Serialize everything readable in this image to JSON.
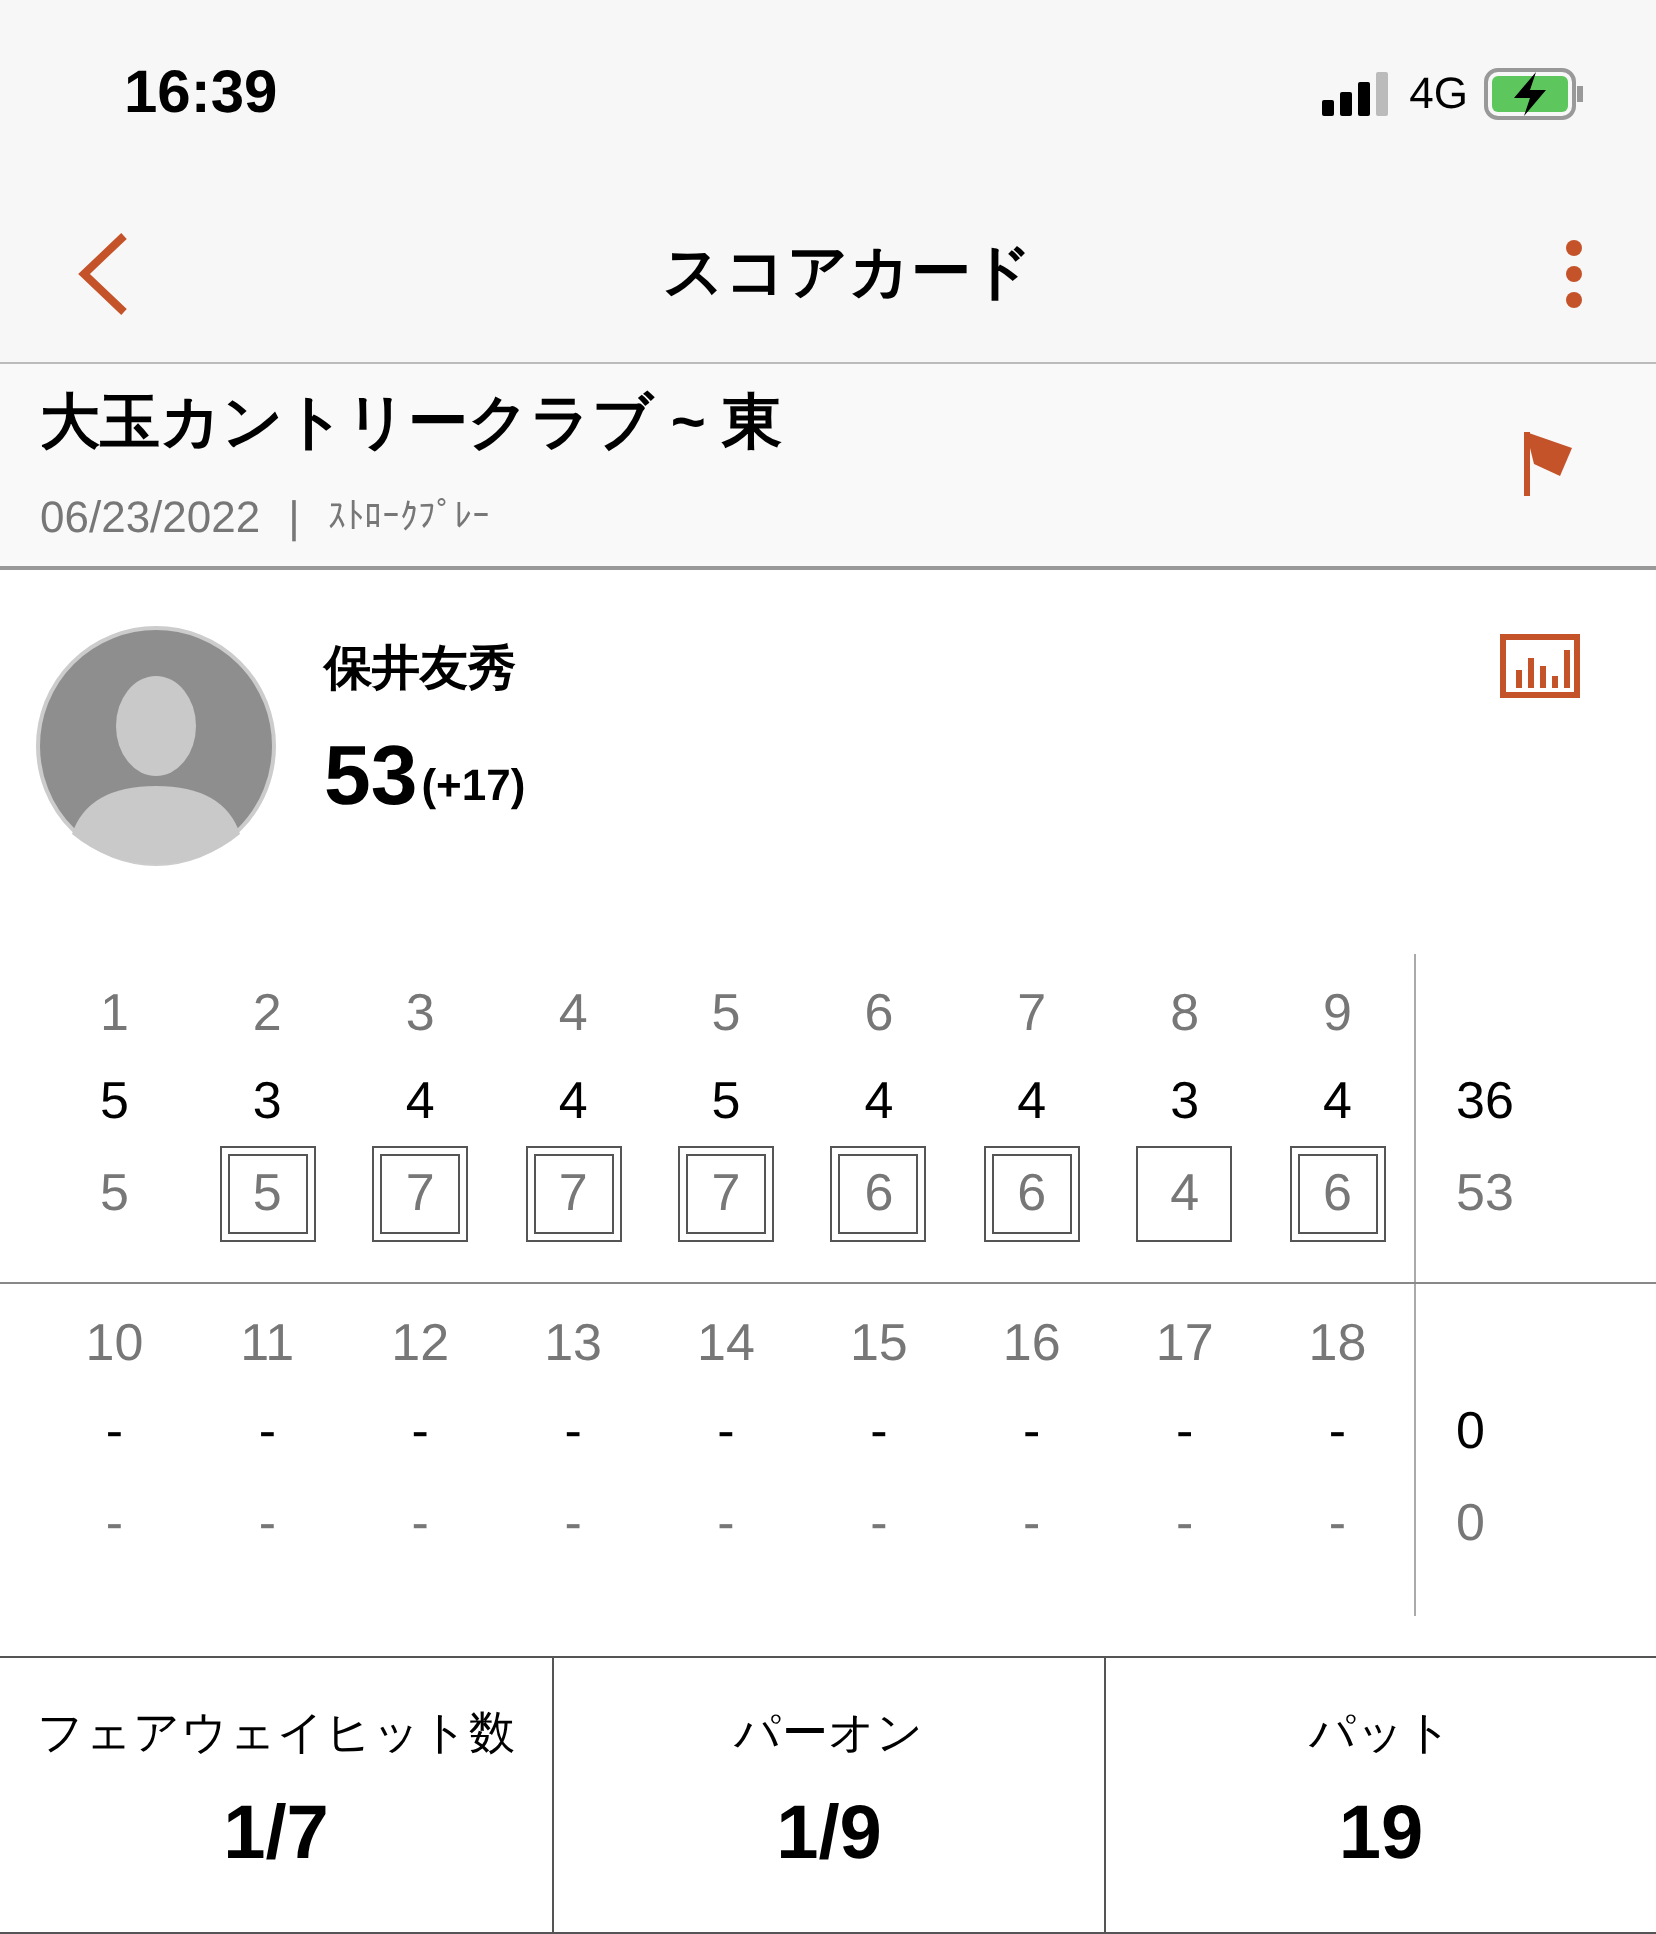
{
  "status_bar": {
    "time": "16:39",
    "network": "4G"
  },
  "nav": {
    "title": "スコアカード"
  },
  "course": {
    "name": "大玉カントリークラブ ~ 東",
    "date": "06/23/2022",
    "separator": "|",
    "format": "ｽﾄﾛｰｸﾌﾟﾚｰ"
  },
  "player": {
    "name": "保井友秀",
    "total": "53",
    "to_par": "(+17)"
  },
  "halves": [
    {
      "holes": [
        "1",
        "2",
        "3",
        "4",
        "5",
        "6",
        "7",
        "8",
        "9"
      ],
      "pars": [
        "5",
        "3",
        "4",
        "4",
        "5",
        "4",
        "4",
        "3",
        "4"
      ],
      "par_total": "36",
      "scores": [
        {
          "value": "5",
          "kind": "plain"
        },
        {
          "value": "5",
          "kind": "double-box"
        },
        {
          "value": "7",
          "kind": "double-box"
        },
        {
          "value": "7",
          "kind": "double-box"
        },
        {
          "value": "7",
          "kind": "double-box"
        },
        {
          "value": "6",
          "kind": "double-box"
        },
        {
          "value": "6",
          "kind": "double-box"
        },
        {
          "value": "4",
          "kind": "box"
        },
        {
          "value": "6",
          "kind": "double-box"
        }
      ],
      "score_total": "53"
    },
    {
      "holes": [
        "10",
        "11",
        "12",
        "13",
        "14",
        "15",
        "16",
        "17",
        "18"
      ],
      "pars": [
        "-",
        "-",
        "-",
        "-",
        "-",
        "-",
        "-",
        "-",
        "-"
      ],
      "par_total": "0",
      "scores": [
        {
          "value": "-",
          "kind": "plain"
        },
        {
          "value": "-",
          "kind": "plain"
        },
        {
          "value": "-",
          "kind": "plain"
        },
        {
          "value": "-",
          "kind": "plain"
        },
        {
          "value": "-",
          "kind": "plain"
        },
        {
          "value": "-",
          "kind": "plain"
        },
        {
          "value": "-",
          "kind": "plain"
        },
        {
          "value": "-",
          "kind": "plain"
        },
        {
          "value": "-",
          "kind": "plain"
        }
      ],
      "score_total": "0"
    }
  ],
  "stats": [
    {
      "label": "フェアウェイヒット数",
      "value": "1/7"
    },
    {
      "label": "パーオン",
      "value": "1/9"
    },
    {
      "label": "パット",
      "value": "19"
    }
  ]
}
